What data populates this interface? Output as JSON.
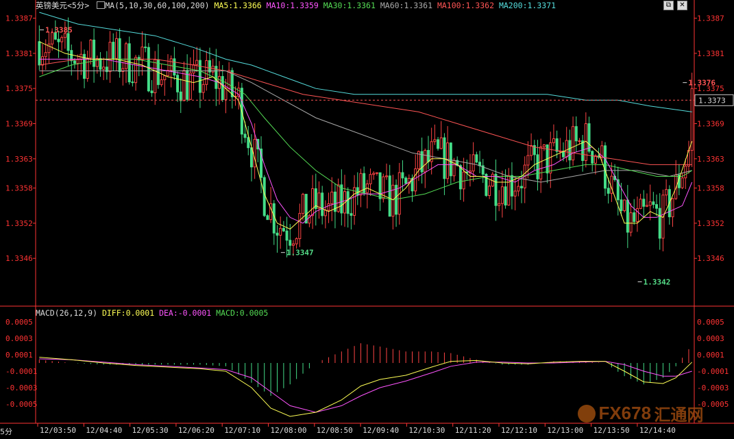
{
  "header": {
    "symbol": "英镑美元",
    "period": "<5分>",
    "ma_label": "MA(5,10,30,60,100,200)",
    "ma_values": [
      {
        "text": "MA5:1.3366",
        "color": "#ffff55"
      },
      {
        "text": "MA10:1.3359",
        "color": "#ff55ff"
      },
      {
        "text": "MA30:1.3361",
        "color": "#55dd55"
      },
      {
        "text": "MA60:1.3361",
        "color": "#aaaaaa"
      },
      {
        "text": "MA100:1.3362",
        "color": "#ff5555"
      },
      {
        "text": "MA200:1.3371",
        "color": "#55dddd"
      }
    ],
    "window_buttons": [
      "⧉",
      "✕"
    ]
  },
  "macd_header": {
    "label": "MACD(26,12,9)",
    "diff": "DIFF:0.0001",
    "dea": "DEA:-0.0001",
    "macd": "MACD:0.0005"
  },
  "period_tag": "5分",
  "watermark": {
    "brand": "FX678",
    "cn": "汇通网"
  },
  "colors": {
    "up": "#ff4444",
    "down": "#44dd88",
    "axis": "#ff3333",
    "ma5": "#ffff55",
    "ma10": "#ff55ff",
    "ma30": "#55dd55",
    "ma60": "#aaaaaa",
    "ma100": "#ff5555",
    "ma200": "#55dddd"
  },
  "chart_data": {
    "type": "candlestick",
    "price_axis": {
      "ticks": [
        "1.3387",
        "1.3381",
        "1.3375",
        "1.3369",
        "1.3363",
        "1.3358",
        "1.3352",
        "1.3346"
      ],
      "range": [
        1.3341,
        1.3388
      ]
    },
    "macd_axis": {
      "ticks": [
        "0.0005",
        "0.0003",
        "0.0001",
        "-0.0001",
        "-0.0003",
        "-0.0005"
      ],
      "range": [
        -0.00065,
        0.00055
      ]
    },
    "current_price": "1.3373",
    "annotations": {
      "high": "1.3385",
      "low1": "1.3347",
      "low2": "1.3342",
      "last_high": "1.3376"
    },
    "x_labels": [
      "12/03:50",
      "12/04:40",
      "12/05:30",
      "12/06:20",
      "12/07:10",
      "12/08:00",
      "12/08:50",
      "12/09:40",
      "12/10:30",
      "12/11:20",
      "12/12:10",
      "12/13:00",
      "12/13:50",
      "12/14:40"
    ],
    "ma_series": {
      "ma5": [
        [
          0,
          1.3383
        ],
        [
          8,
          1.3381
        ],
        [
          16,
          1.338
        ],
        [
          24,
          1.338
        ],
        [
          32,
          1.3379
        ],
        [
          40,
          1.3377
        ],
        [
          48,
          1.3376
        ],
        [
          54,
          1.3377
        ],
        [
          58,
          1.3375
        ],
        [
          62,
          1.3373
        ],
        [
          66,
          1.3365
        ],
        [
          70,
          1.3357
        ],
        [
          74,
          1.3352
        ],
        [
          78,
          1.3351
        ],
        [
          82,
          1.3353
        ],
        [
          86,
          1.3355
        ],
        [
          90,
          1.3354
        ],
        [
          94,
          1.3355
        ],
        [
          98,
          1.3357
        ],
        [
          102,
          1.3358
        ],
        [
          106,
          1.3357
        ],
        [
          110,
          1.3356
        ],
        [
          114,
          1.3358
        ],
        [
          118,
          1.3361
        ],
        [
          122,
          1.3363
        ],
        [
          126,
          1.3363
        ],
        [
          130,
          1.3362
        ],
        [
          134,
          1.336
        ],
        [
          138,
          1.336
        ],
        [
          142,
          1.3359
        ],
        [
          146,
          1.3359
        ],
        [
          150,
          1.336
        ],
        [
          154,
          1.3362
        ],
        [
          158,
          1.3363
        ],
        [
          162,
          1.3364
        ],
        [
          166,
          1.3365
        ],
        [
          170,
          1.3366
        ],
        [
          174,
          1.3364
        ],
        [
          178,
          1.3358
        ],
        [
          182,
          1.3352
        ],
        [
          186,
          1.3352
        ],
        [
          190,
          1.3354
        ],
        [
          194,
          1.3353
        ],
        [
          198,
          1.3358
        ],
        [
          203,
          1.3366
        ]
      ],
      "ma10": [
        [
          0,
          1.338
        ],
        [
          10,
          1.338
        ],
        [
          20,
          1.338
        ],
        [
          30,
          1.3379
        ],
        [
          40,
          1.3378
        ],
        [
          50,
          1.3377
        ],
        [
          56,
          1.3376
        ],
        [
          62,
          1.3374
        ],
        [
          66,
          1.3369
        ],
        [
          70,
          1.3362
        ],
        [
          74,
          1.3356
        ],
        [
          78,
          1.3353
        ],
        [
          82,
          1.3352
        ],
        [
          86,
          1.3354
        ],
        [
          90,
          1.3355
        ],
        [
          96,
          1.3356
        ],
        [
          100,
          1.3357
        ],
        [
          106,
          1.3357
        ],
        [
          112,
          1.3358
        ],
        [
          118,
          1.336
        ],
        [
          124,
          1.3362
        ],
        [
          130,
          1.3362
        ],
        [
          136,
          1.336
        ],
        [
          142,
          1.336
        ],
        [
          148,
          1.3359
        ],
        [
          154,
          1.3361
        ],
        [
          160,
          1.3362
        ],
        [
          166,
          1.3364
        ],
        [
          172,
          1.3365
        ],
        [
          176,
          1.3363
        ],
        [
          180,
          1.3359
        ],
        [
          184,
          1.3355
        ],
        [
          188,
          1.3353
        ],
        [
          192,
          1.3353
        ],
        [
          196,
          1.3354
        ],
        [
          200,
          1.3355
        ],
        [
          203,
          1.3359
        ]
      ],
      "ma30": [
        [
          0,
          1.3377
        ],
        [
          10,
          1.3379
        ],
        [
          20,
          1.338
        ],
        [
          30,
          1.338
        ],
        [
          40,
          1.3379
        ],
        [
          50,
          1.3378
        ],
        [
          58,
          1.3376
        ],
        [
          64,
          1.3374
        ],
        [
          70,
          1.337
        ],
        [
          78,
          1.3365
        ],
        [
          86,
          1.3361
        ],
        [
          94,
          1.3358
        ],
        [
          102,
          1.3357
        ],
        [
          110,
          1.3356
        ],
        [
          120,
          1.3357
        ],
        [
          130,
          1.3359
        ],
        [
          140,
          1.336
        ],
        [
          150,
          1.336
        ],
        [
          160,
          1.3361
        ],
        [
          170,
          1.3362
        ],
        [
          176,
          1.3362
        ],
        [
          184,
          1.3361
        ],
        [
          192,
          1.336
        ],
        [
          200,
          1.336
        ],
        [
          203,
          1.3361
        ]
      ],
      "ma60": [
        [
          0,
          1.3378
        ],
        [
          12,
          1.3378
        ],
        [
          24,
          1.3378
        ],
        [
          36,
          1.3378
        ],
        [
          48,
          1.3378
        ],
        [
          58,
          1.3378
        ],
        [
          66,
          1.3376
        ],
        [
          76,
          1.3373
        ],
        [
          86,
          1.337
        ],
        [
          96,
          1.3368
        ],
        [
          106,
          1.3366
        ],
        [
          116,
          1.3364
        ],
        [
          126,
          1.3363
        ],
        [
          136,
          1.3362
        ],
        [
          146,
          1.336
        ],
        [
          156,
          1.3359
        ],
        [
          166,
          1.336
        ],
        [
          176,
          1.3361
        ],
        [
          186,
          1.3361
        ],
        [
          196,
          1.336
        ],
        [
          203,
          1.3361
        ]
      ],
      "ma100": [
        [
          0,
          1.3379
        ],
        [
          12,
          1.338
        ],
        [
          24,
          1.338
        ],
        [
          36,
          1.338
        ],
        [
          48,
          1.3379
        ],
        [
          58,
          1.3378
        ],
        [
          70,
          1.3376
        ],
        [
          82,
          1.3374
        ],
        [
          94,
          1.3373
        ],
        [
          106,
          1.3372
        ],
        [
          118,
          1.3371
        ],
        [
          130,
          1.3369
        ],
        [
          142,
          1.3367
        ],
        [
          154,
          1.3365
        ],
        [
          166,
          1.3364
        ],
        [
          178,
          1.3363
        ],
        [
          190,
          1.3362
        ],
        [
          203,
          1.3362
        ]
      ],
      "ma200": [
        [
          0,
          1.3388
        ],
        [
          12,
          1.3386
        ],
        [
          24,
          1.3385
        ],
        [
          36,
          1.3384
        ],
        [
          48,
          1.3382
        ],
        [
          58,
          1.338
        ],
        [
          66,
          1.3379
        ],
        [
          76,
          1.3377
        ],
        [
          86,
          1.3375
        ],
        [
          98,
          1.3374
        ],
        [
          110,
          1.3374
        ],
        [
          122,
          1.3374
        ],
        [
          134,
          1.3374
        ],
        [
          146,
          1.3374
        ],
        [
          158,
          1.3374
        ],
        [
          170,
          1.3373
        ],
        [
          180,
          1.3373
        ],
        [
          190,
          1.3372
        ],
        [
          203,
          1.3371
        ]
      ]
    },
    "macd_series": {
      "diff": [
        [
          0,
          7e-05
        ],
        [
          10,
          4e-05
        ],
        [
          20,
          0.0
        ],
        [
          30,
          -3e-05
        ],
        [
          40,
          -5e-05
        ],
        [
          50,
          -7e-05
        ],
        [
          58,
          -0.0001
        ],
        [
          66,
          -0.0003
        ],
        [
          72,
          -0.00055
        ],
        [
          78,
          -0.00065
        ],
        [
          86,
          -0.0006
        ],
        [
          94,
          -0.00045
        ],
        [
          100,
          -0.00028
        ],
        [
          106,
          -0.0002
        ],
        [
          114,
          -0.00015
        ],
        [
          122,
          -5e-05
        ],
        [
          128,
          2e-05
        ],
        [
          136,
          3e-05
        ],
        [
          144,
          0.0
        ],
        [
          152,
          -1e-05
        ],
        [
          160,
          1e-05
        ],
        [
          168,
          2e-05
        ],
        [
          176,
          2e-05
        ],
        [
          182,
          -0.0001
        ],
        [
          188,
          -0.00023
        ],
        [
          194,
          -0.00025
        ],
        [
          198,
          -0.00018
        ],
        [
          203,
          1e-05
        ]
      ],
      "dea": [
        [
          0,
          5e-05
        ],
        [
          10,
          4e-05
        ],
        [
          20,
          1e-05
        ],
        [
          30,
          -2e-05
        ],
        [
          40,
          -4e-05
        ],
        [
          50,
          -6e-05
        ],
        [
          58,
          -8e-05
        ],
        [
          66,
          -0.00018
        ],
        [
          72,
          -0.00035
        ],
        [
          78,
          -0.00052
        ],
        [
          86,
          -0.0006
        ],
        [
          94,
          -0.00052
        ],
        [
          100,
          -0.0004
        ],
        [
          106,
          -0.0003
        ],
        [
          114,
          -0.00022
        ],
        [
          122,
          -0.00012
        ],
        [
          128,
          -4e-05
        ],
        [
          136,
          1e-05
        ],
        [
          144,
          1e-05
        ],
        [
          152,
          0.0
        ],
        [
          160,
          0.0
        ],
        [
          168,
          1e-05
        ],
        [
          176,
          2e-05
        ],
        [
          182,
          -2e-05
        ],
        [
          188,
          -0.0001
        ],
        [
          194,
          -0.00016
        ],
        [
          198,
          -0.00016
        ],
        [
          203,
          -0.0001
        ]
      ]
    }
  }
}
